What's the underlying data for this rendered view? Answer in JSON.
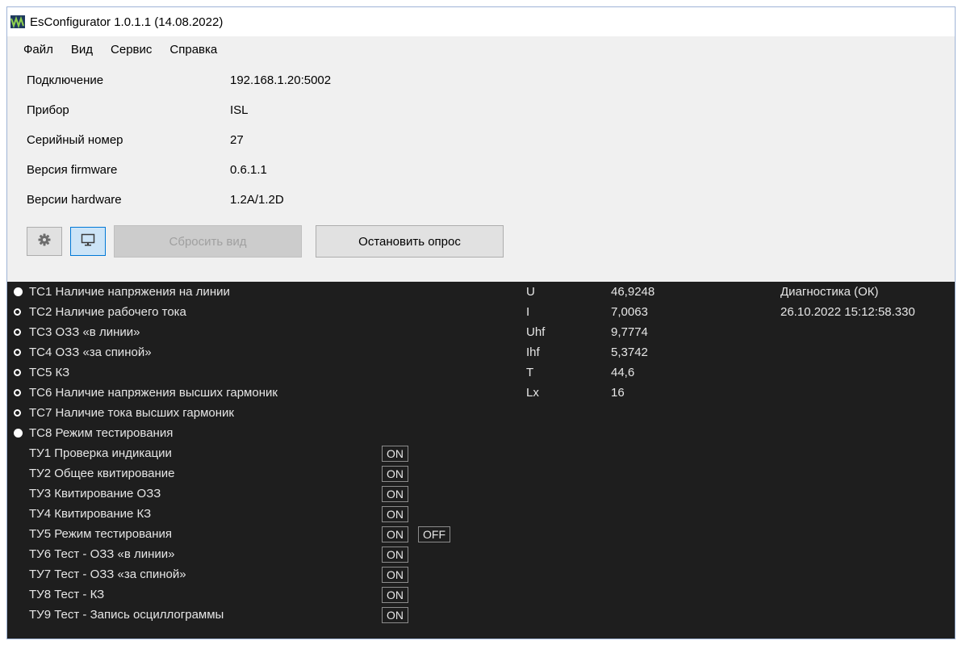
{
  "window": {
    "title": "EsConfigurator 1.0.1.1 (14.08.2022)"
  },
  "menu": [
    "Файл",
    "Вид",
    "Сервис",
    "Справка"
  ],
  "info": [
    {
      "label": "Подключение",
      "value": "192.168.1.20:5002"
    },
    {
      "label": "Прибор",
      "value": "ISL"
    },
    {
      "label": "Серийный номер",
      "value": "27"
    },
    {
      "label": "Версия firmware",
      "value": "0.6.1.1"
    },
    {
      "label": "Версии hardware",
      "value": "1.2A/1.2D"
    }
  ],
  "toolbar": {
    "settings_icon": "gear-icon",
    "monitor_icon": "monitor-icon",
    "reset_view_label": "Сбросить вид",
    "stop_polling_label": "Остановить опрос"
  },
  "colors": {
    "panel_bg": "#1e1e1e",
    "panel_text": "#e6e6e6",
    "active_button_bg": "#cce4f7",
    "active_button_border": "#0078d7"
  },
  "tc": [
    {
      "label": "ТС1 Наличие напряжения на линии",
      "state": "on"
    },
    {
      "label": "ТС2 Наличие рабочего тока",
      "state": "off"
    },
    {
      "label": "ТС3 ОЗЗ «в линии»",
      "state": "off"
    },
    {
      "label": "ТС4 ОЗЗ «за спиной»",
      "state": "off"
    },
    {
      "label": "ТС5 КЗ",
      "state": "off"
    },
    {
      "label": "ТС6 Наличие напряжения высших гармоник",
      "state": "off"
    },
    {
      "label": "ТС7 Наличие тока высших гармоник",
      "state": "off"
    },
    {
      "label": "ТС8 Режим тестирования",
      "state": "on"
    }
  ],
  "params": [
    {
      "name": "U",
      "value": "46,9248"
    },
    {
      "name": "I",
      "value": "7,0063"
    },
    {
      "name": "Uhf",
      "value": "9,7774"
    },
    {
      "name": "Ihf",
      "value": "5,3742"
    },
    {
      "name": "T",
      "value": "44,6"
    },
    {
      "name": "Lx",
      "value": "16"
    }
  ],
  "diagnostics": {
    "status": "Диагностика (ОК)",
    "timestamp": "26.10.2022 15:12:58.330"
  },
  "tu": [
    {
      "label": "ТУ1 Проверка индикации",
      "on": "ON"
    },
    {
      "label": "ТУ2 Общее квитирование",
      "on": "ON"
    },
    {
      "label": "ТУ3 Квитирование ОЗЗ",
      "on": "ON"
    },
    {
      "label": "ТУ4 Квитирование КЗ",
      "on": "ON"
    },
    {
      "label": "ТУ5 Режим тестирования",
      "on": "ON",
      "off": "OFF"
    },
    {
      "label": "ТУ6 Тест - ОЗЗ «в линии»",
      "on": "ON"
    },
    {
      "label": "ТУ7 Тест - ОЗЗ «за спиной»",
      "on": "ON"
    },
    {
      "label": "ТУ8 Тест - КЗ",
      "on": "ON"
    },
    {
      "label": "ТУ9 Тест - Запись осциллограммы",
      "on": "ON"
    }
  ]
}
